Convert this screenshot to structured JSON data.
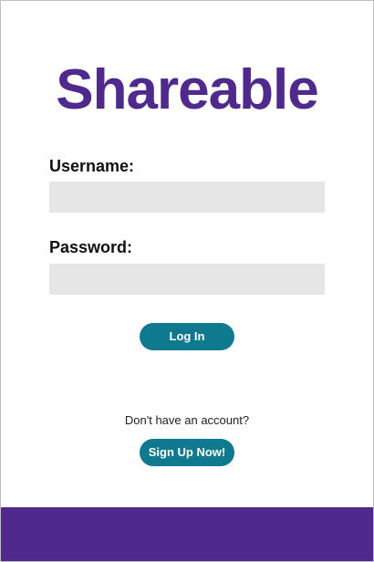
{
  "app": {
    "title": "Shareable"
  },
  "login_form": {
    "username_label": "Username:",
    "username_value": "",
    "password_label": "Password:",
    "password_value": "",
    "login_button": "Log In"
  },
  "signup": {
    "prompt": "Don't have an account?",
    "button": "Sign Up Now!"
  },
  "colors": {
    "brand_purple": "#4f2a8c",
    "button_teal": "#0f7a8f",
    "input_background": "#e6e6e6"
  }
}
